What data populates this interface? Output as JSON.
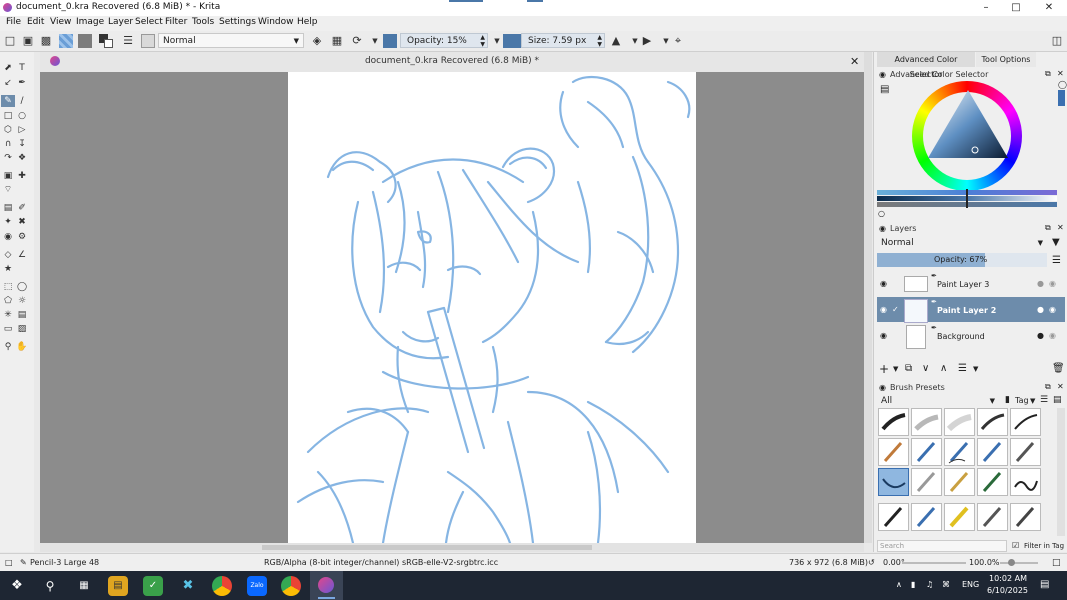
{
  "window": {
    "title": "document_0.kra Recovered (6.8 MiB) * - Krita",
    "minimize": "–",
    "maximize": "□",
    "close": "✕"
  },
  "menu": [
    "File",
    "Edit",
    "View",
    "Image",
    "Layer",
    "Select",
    "Filter",
    "Tools",
    "Settings",
    "Window",
    "Help"
  ],
  "toolbar": {
    "blend_mode": "Normal",
    "opacity": "Opacity: 15%",
    "size": "Size: 7.59 px"
  },
  "document": {
    "tab_title": "document_0.kra Recovered (6.8 MiB) *",
    "close": "✕"
  },
  "dock": {
    "tabs": [
      "Advanced Color Selector",
      "Tool Options"
    ],
    "color_selector_title": "Advanced Color Selector",
    "layers_title": "Layers",
    "layers_blend": "Normal",
    "layers_opacity": "Opacity:  67%",
    "layers": [
      {
        "name": "Paint Layer 3",
        "active": false
      },
      {
        "name": "Paint Layer 2",
        "active": true
      },
      {
        "name": "Background",
        "active": false
      }
    ],
    "presets_title": "Brush Presets",
    "presets_filter": "All",
    "presets_tag": "Tag",
    "search_placeholder": "Search",
    "filter_in_tag": "Filter in Tag"
  },
  "status": {
    "brush": "Pencil-3 Large 48",
    "colorspace": "RGB/Alpha (8-bit integer/channel)  sRGB-elle-V2-srgbtrc.icc",
    "dimensions": "736 x 972 (6.8 MiB)",
    "rotation": "0.00°",
    "zoom": "100.0%"
  },
  "taskbar": {
    "lang": "ENG",
    "time": "10:02 AM",
    "date": "6/10/2025",
    "zalo": "Zalo"
  },
  "colors": {
    "accent": "#4a77a8",
    "sketch": "#7aaee0",
    "layer_active": "#6d8cab"
  }
}
